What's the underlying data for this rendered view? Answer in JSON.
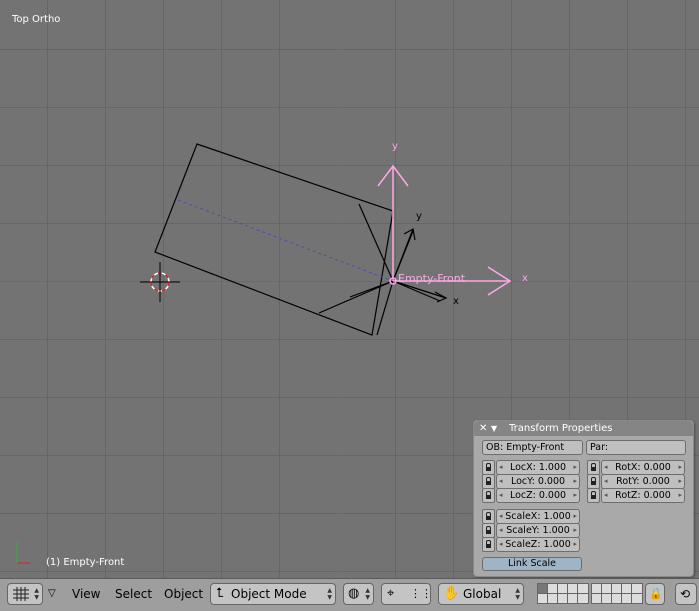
{
  "viewport": {
    "title": "Top Ortho",
    "status": "(1) Empty-Front",
    "object_label": "Empty-Front",
    "axis_labels": {
      "local_y": "y",
      "local_x": "x",
      "global_y": "y",
      "global_x": "x"
    }
  },
  "transform_panel": {
    "title": "Transform Properties",
    "ob_field": "OB: Empty-Front",
    "par_field": "Par:",
    "loc": [
      "LocX: 1.000",
      "LocY: 0.000",
      "LocZ: 0.000"
    ],
    "rot": [
      "RotX: 0.000",
      "RotY: 0.000",
      "RotZ: 0.000"
    ],
    "scale": [
      "ScaleX: 1.000",
      "ScaleY: 1.000",
      "ScaleZ: 1.000"
    ],
    "link_scale": "Link Scale"
  },
  "header": {
    "menus": [
      "View",
      "Select",
      "Object"
    ],
    "mode": "Object Mode",
    "orientation": "Global"
  },
  "colors": {
    "grid_bg": "#737373",
    "x_axis": "#c05060",
    "y_axis": "#3c9a3c",
    "gizmo": "#ffa8e8"
  }
}
